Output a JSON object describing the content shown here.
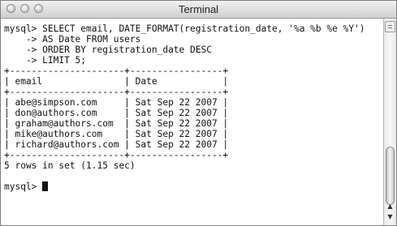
{
  "window": {
    "title": "Terminal"
  },
  "terminal": {
    "lines": [
      "mysql> SELECT email, DATE_FORMAT(registration_date, '%a %b %e %Y')",
      "    -> AS Date FROM users",
      "    -> ORDER BY registration_date DESC",
      "    -> LIMIT 5;",
      "+---------------------+-----------------+",
      "| email               | Date            |",
      "+---------------------+-----------------+",
      "| abe@simpson.com     | Sat Sep 22 2007 |",
      "| don@authors.com     | Sat Sep 22 2007 |",
      "| graham@authors.com  | Sat Sep 22 2007 |",
      "| mike@authors.com    | Sat Sep 22 2007 |",
      "| richard@authors.com | Sat Sep 22 2007 |",
      "+---------------------+-----------------+",
      "5 rows in set (1.15 sec)",
      "",
      "mysql> "
    ]
  },
  "icons": {
    "window_buttons": [
      "close-button",
      "minimize-button",
      "zoom-button"
    ],
    "scroll_up": "▲",
    "scroll_down": "▼"
  }
}
